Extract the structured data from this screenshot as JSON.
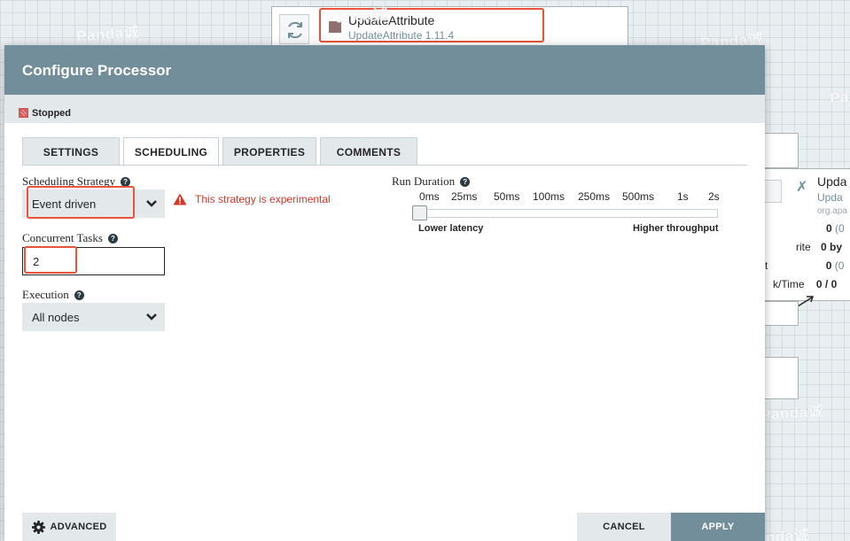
{
  "canvas": {
    "top_processor": {
      "name": "UpdateAttribute",
      "type": "UpdateAttribute 1.11.4"
    },
    "right_processor": {
      "title": "Upda",
      "subtitle": "Upda",
      "package": "org.apa",
      "stats": [
        {
          "label": "",
          "value": "0",
          "extra": "(0"
        },
        {
          "label": "rite",
          "value": "0 by",
          "extra": ""
        },
        {
          "label": "t",
          "value": "0",
          "extra": "(0"
        },
        {
          "label": "k/Time",
          "value": "0 / 0",
          "extra": ""
        }
      ]
    },
    "watermark": "Panda诚"
  },
  "dialog": {
    "title": "Configure Processor",
    "status": "Stopped",
    "tabs": [
      {
        "label": "SETTINGS",
        "active": false
      },
      {
        "label": "SCHEDULING",
        "active": true
      },
      {
        "label": "PROPERTIES",
        "active": false
      },
      {
        "label": "COMMENTS",
        "active": false
      }
    ],
    "scheduling_strategy": {
      "label": "Scheduling Strategy",
      "value": "Event driven",
      "warning": "This strategy is experimental"
    },
    "concurrent_tasks": {
      "label": "Concurrent Tasks",
      "value": "2"
    },
    "execution": {
      "label": "Execution",
      "value": "All nodes"
    },
    "run_duration": {
      "label": "Run Duration",
      "ticks": [
        "0ms",
        "25ms",
        "50ms",
        "100ms",
        "250ms",
        "500ms",
        "1s",
        "2s"
      ],
      "selected": "0ms",
      "low_label": "Lower latency",
      "high_label": "Higher throughput"
    },
    "buttons": {
      "advanced": "ADVANCED",
      "cancel": "CANCEL",
      "apply": "APPLY"
    }
  },
  "colors": {
    "header": "#728e9b",
    "accent_red": "#e8533a",
    "warning": "#d6372a"
  }
}
